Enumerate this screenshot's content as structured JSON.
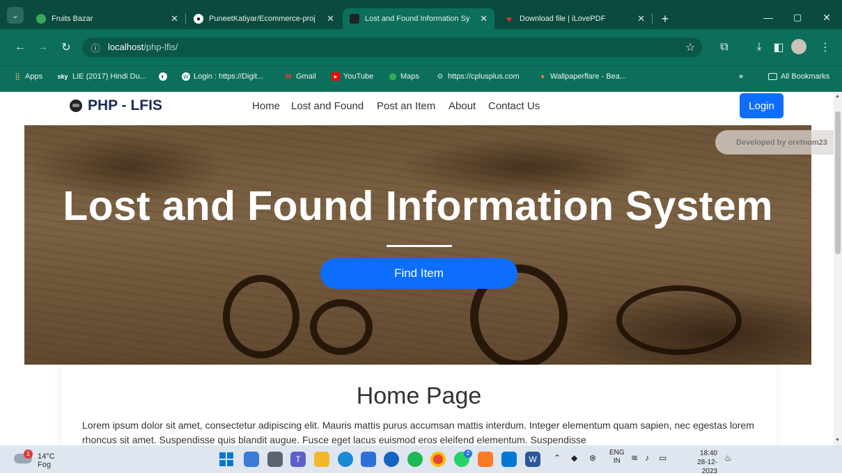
{
  "browser": {
    "tabs": [
      {
        "title": "Fruits Bazar",
        "icon": "leaf-icon"
      },
      {
        "title": "PuneetKatiyar/Ecommerce-proj",
        "icon": "github-icon"
      },
      {
        "title": "Lost and Found Information Sy",
        "icon": "lfis-icon",
        "active": true
      },
      {
        "title": "Download file | iLovePDF",
        "icon": "heart-icon"
      }
    ],
    "url_host": "localhost",
    "url_path": "/php-lfis/",
    "bookmarks": [
      {
        "label": "Apps"
      },
      {
        "label": "LIE (2017) Hindi Du..."
      },
      {
        "label": ""
      },
      {
        "label": "Login : https://Digit..."
      },
      {
        "label": "Gmail"
      },
      {
        "label": "YouTube"
      },
      {
        "label": "Maps"
      },
      {
        "label": "https://cplusplus.com"
      },
      {
        "label": "Wallpaperflare - Bea..."
      }
    ],
    "all_bookmarks": "All Bookmarks",
    "overflow": "»"
  },
  "site": {
    "brand": "PHP - LFIS",
    "nav": [
      "Home",
      "Lost and Found",
      "Post an Item",
      "About",
      "Contact Us"
    ],
    "login": "Login",
    "hero_title": "Lost and Found Information System",
    "find_item": "Find Item",
    "dev_badge": "Developed by oretnom23",
    "home_heading": "Home Page",
    "home_text": "Lorem ipsum dolor sit amet, consectetur adipiscing elit. Mauris mattis purus accumsan mattis interdum. Integer elementum quam sapien, nec egestas lorem rhoncus sit amet. Suspendisse quis blandit augue. Fusce eget lacus euismod eros eleifend elementum. Suspendisse"
  },
  "taskbar": {
    "weather_temp": "14°C",
    "weather_desc": "Fog",
    "weather_badge": "1",
    "lang_line1": "ENG",
    "lang_line2": "IN",
    "time": "18:40",
    "date": "28-12-2023",
    "whatsapp_badge": "2"
  }
}
